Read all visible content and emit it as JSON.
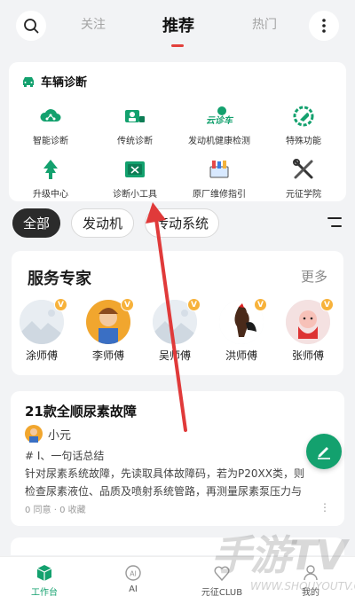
{
  "top_tabs": {
    "follow": "关注",
    "recommend": "推荐",
    "hot": "热门"
  },
  "diagnosis": {
    "title": "车辆诊断",
    "items": [
      {
        "label": "智能诊断",
        "icon": "cloud-network-icon"
      },
      {
        "label": "传统诊断",
        "icon": "mechanic-diagnosis-icon"
      },
      {
        "label": "发动机健康检测",
        "icon": "yunzhenche-logo-icon"
      },
      {
        "label": "特殊功能",
        "icon": "wrench-gear-icon"
      },
      {
        "label": "升级中心",
        "icon": "upgrade-tree-icon"
      },
      {
        "label": "诊断小工具",
        "icon": "toolbox-icon"
      },
      {
        "label": "原厂维修指引",
        "icon": "repair-manual-icon"
      },
      {
        "label": "元征学院",
        "icon": "tools-cross-icon"
      }
    ]
  },
  "chips": [
    "全部",
    "发动机",
    "传动系统"
  ],
  "experts": {
    "title": "服务专家",
    "more": "更多",
    "list": [
      {
        "name": "涂师傅",
        "badge": "V"
      },
      {
        "name": "李师傅",
        "badge": "V"
      },
      {
        "name": "吴师傅",
        "badge": "V"
      },
      {
        "name": "洪师傅",
        "badge": "V"
      },
      {
        "name": "张师傅",
        "badge": "V"
      }
    ]
  },
  "post": {
    "title": "21款全顺尿素故障",
    "author": "小元",
    "section": "# I、一句话总结",
    "line1": "针对尿素系统故障，先读取具体故障码，若为P20XX类，则",
    "line2": "检查尿素液位、品质及喷射系统管路，再测量尿素泵压力与",
    "meta": "0 同意 · 0 收藏",
    "dots": "⋮"
  },
  "bottom_nav": [
    {
      "label": "工作台",
      "icon": "workbench-cube-icon",
      "active": true
    },
    {
      "label": "AI",
      "icon": "ai-icon",
      "active": false
    },
    {
      "label": "元征CLUB",
      "icon": "club-icon",
      "active": false
    },
    {
      "label": "我的",
      "icon": "profile-icon",
      "active": false
    }
  ],
  "colors": {
    "accent": "#13a16e",
    "tab_underline": "#e2403b",
    "arrow": "#e03a3a",
    "badge": "#f7b23b"
  },
  "watermark": {
    "text": "手游TV",
    "url": "WWW.SHOUYOUTV.COM"
  }
}
